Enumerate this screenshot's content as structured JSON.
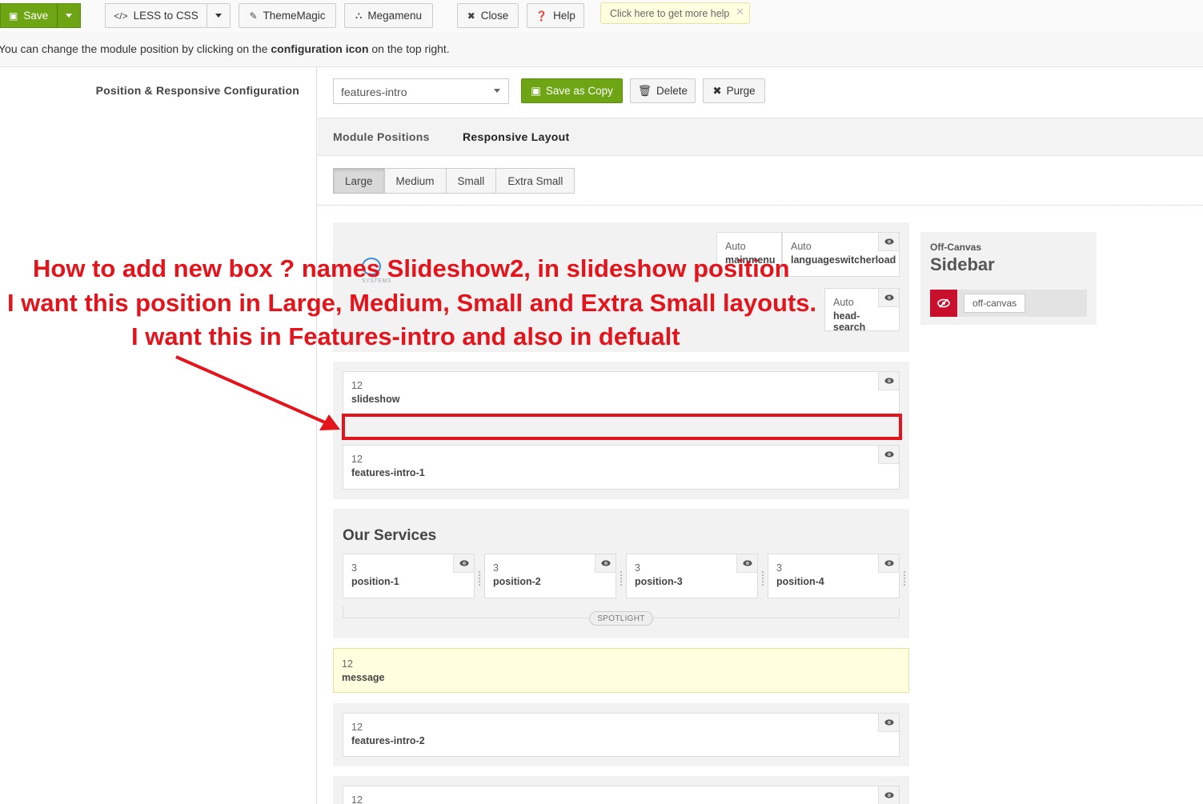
{
  "toolbar": {
    "save": "Save",
    "less_to_css": "LESS to CSS",
    "theme_magic": "ThemeMagic",
    "megamenu": "Megamenu",
    "close": "Close",
    "help": "Help",
    "help_tip": "Click here to get more help"
  },
  "description": {
    "prefix": "You can change the module position by clicking on the ",
    "bold": "configuration icon",
    "suffix": " on the top right."
  },
  "config": {
    "label": "Position & Responsive Configuration",
    "selected_layout": "features-intro",
    "save_as_copy": "Save as Copy",
    "delete": "Delete",
    "purge": "Purge"
  },
  "tabs": [
    "Module Positions",
    "Responsive Layout"
  ],
  "devices": [
    "Large",
    "Medium",
    "Small",
    "Extra Small"
  ],
  "header_section": {
    "logo_text": "SYSTEMS",
    "mainmenu": {
      "span": "Auto",
      "name": "mainmenu"
    },
    "langswitch": {
      "span": "Auto",
      "name": "languageswitcherload"
    },
    "headsearch": {
      "span": "Auto",
      "name": "head-search"
    }
  },
  "slideshow_section": {
    "slideshow": {
      "span": "12",
      "name": "slideshow"
    },
    "features_intro_1": {
      "span": "12",
      "name": "features-intro-1"
    }
  },
  "services_section": {
    "title": "Our Services",
    "positions": [
      {
        "span": "3",
        "name": "position-1"
      },
      {
        "span": "3",
        "name": "position-2"
      },
      {
        "span": "3",
        "name": "position-3"
      },
      {
        "span": "3",
        "name": "position-4"
      }
    ],
    "spotlight": "SPOTLIGHT"
  },
  "message": {
    "span": "12",
    "name": "message"
  },
  "features_intro_2": {
    "span": "12",
    "name": "features-intro-2"
  },
  "next_block": {
    "span": "12"
  },
  "offcanvas": {
    "label": "Off-Canvas",
    "title": "Sidebar",
    "position": "off-canvas"
  },
  "annotation": {
    "line1": "How to add new box ? names Slideshow2, in slideshow position",
    "line2": "I want this position in Large, Medium, Small and Extra Small layouts.",
    "line3": "I want this in Features-intro and also in defualt"
  },
  "colors": {
    "green": "#6ea514",
    "annotation_red": "#e3141b",
    "offcanvas_red": "#c8102e"
  }
}
